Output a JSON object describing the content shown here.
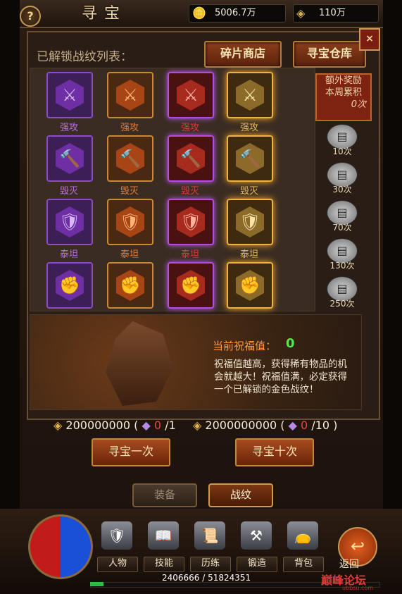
{
  "header": {
    "title": "寻宝",
    "help": "?",
    "gold": "5006.7万",
    "money": "110万"
  },
  "panel": {
    "list_label": "已解锁战纹列表：",
    "shop_button": "碎片商店",
    "warehouse_button": "寻宝仓库",
    "close": "×"
  },
  "rows": [
    {
      "name": "强攻",
      "icon": "sword-icon",
      "glyph": "⚔"
    },
    {
      "name": "毁灭",
      "icon": "hammer-icon",
      "glyph": "🔨"
    },
    {
      "name": "泰坦",
      "icon": "shield-icon",
      "glyph": "🛡"
    },
    {
      "name": "",
      "icon": "fist-icon",
      "glyph": "✊"
    }
  ],
  "rarity_colors": {
    "purple": "#b86de7",
    "orange": "#e07c35",
    "red": "#e13b3b",
    "gold": "#e2bb5e"
  },
  "rewards": {
    "title_line1": "额外奖励",
    "title_line2": "本周累积",
    "count": "0次",
    "chests": [
      "10次",
      "30次",
      "70次",
      "130次",
      "250次"
    ]
  },
  "blessing": {
    "label": "当前祝福值：",
    "value": "0",
    "desc": "祝福值越高，获得稀有物品的机会就越大！祝福值满，必定获得一个已解锁的金色战纹！"
  },
  "costs": {
    "single": {
      "gold": "200000000",
      "paren_open": "(",
      "owned": "0",
      "need": "/1"
    },
    "ten": {
      "gold": "2000000000",
      "paren_open": "(",
      "owned": "0",
      "need": "/10",
      "paren_close": ")"
    }
  },
  "actions": {
    "once": "寻宝一次",
    "ten": "寻宝十次"
  },
  "tabs": {
    "equip": "装备",
    "rune": "战纹"
  },
  "nav": {
    "items": [
      "人物",
      "技能",
      "历练",
      "锻造",
      "背包"
    ],
    "back": "返回",
    "xp": "2406666 / 51824351",
    "xp_fraction": 0.046
  },
  "watermark": {
    "text": "巅峰论坛",
    "sub": "ubbsu.com"
  }
}
